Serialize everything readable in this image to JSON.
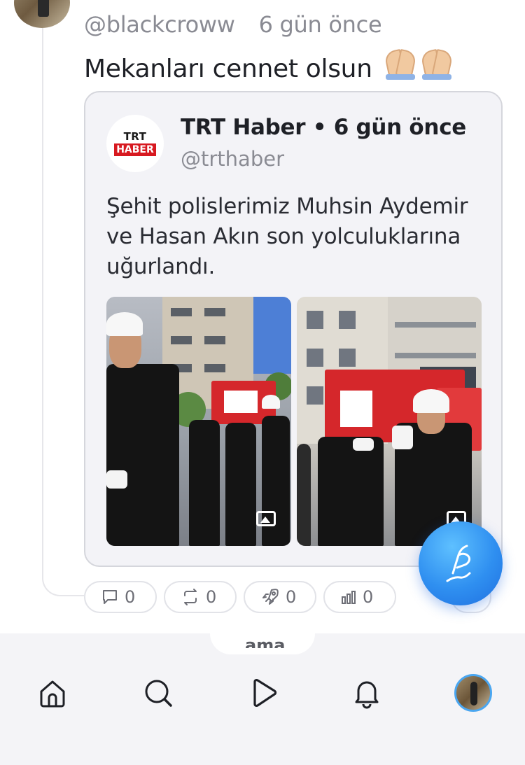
{
  "post": {
    "handle": "@blackcroww",
    "time": "6 gün önce",
    "text": "Mekanları cennet olsun"
  },
  "quoted": {
    "author_name": "TRT Haber",
    "separator": "•",
    "time": "6 gün önce",
    "handle": "@trthaber",
    "logo_top": "TRT",
    "logo_bottom": "HABER",
    "text": "Şehit polislerimiz Muhsin Aydemir ve Hasan Akın son yolculuklarına uğurlandı.",
    "images": [
      {
        "icon": "image-icon"
      },
      {
        "icon": "image-icon"
      }
    ]
  },
  "actions": {
    "comments": "0",
    "reposts": "0",
    "boosts": "0",
    "views": "0"
  },
  "nav": {
    "peek_text": "ama"
  },
  "colors": {
    "accent": "#2f8ff0",
    "trt_red": "#d71920",
    "muted_text": "#8a8b93",
    "card_bg": "#f3f3f7"
  }
}
